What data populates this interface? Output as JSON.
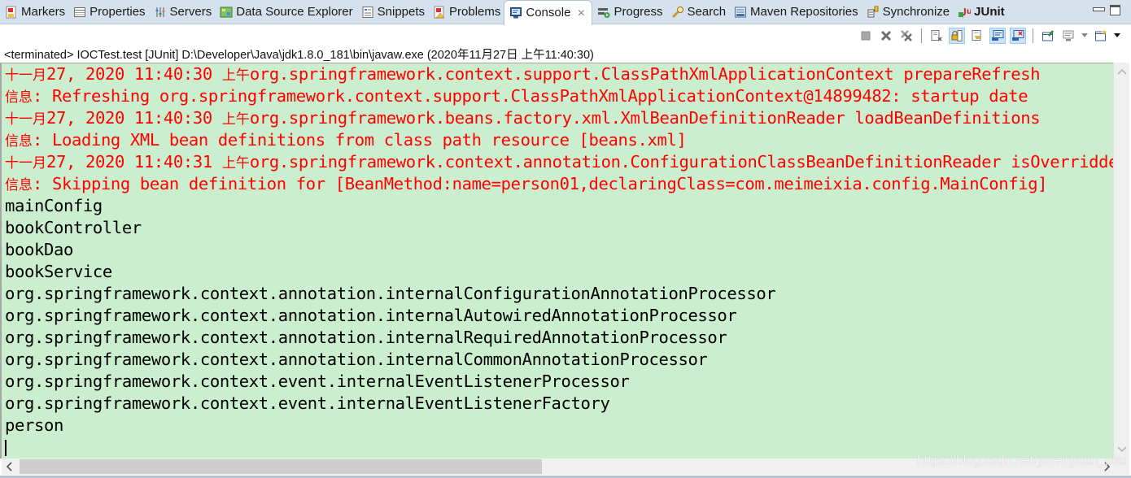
{
  "tabs": [
    {
      "label": "Markers",
      "icon": "markers-icon"
    },
    {
      "label": "Properties",
      "icon": "properties-icon"
    },
    {
      "label": "Servers",
      "icon": "servers-icon"
    },
    {
      "label": "Data Source Explorer",
      "icon": "data-source-explorer-icon"
    },
    {
      "label": "Snippets",
      "icon": "snippets-icon"
    },
    {
      "label": "Problems",
      "icon": "problems-icon"
    },
    {
      "label": "Console",
      "icon": "console-icon",
      "active": true,
      "close_glyph": "✕"
    },
    {
      "label": "Progress",
      "icon": "progress-icon"
    },
    {
      "label": "Search",
      "icon": "search-icon"
    },
    {
      "label": "Maven Repositories",
      "icon": "maven-repositories-icon"
    },
    {
      "label": "Synchronize",
      "icon": "synchronize-icon"
    },
    {
      "label": "JUnit",
      "icon": "junit-icon"
    }
  ],
  "toolbar": {
    "buttons": [
      {
        "name": "terminate",
        "icon": "stop-icon"
      },
      {
        "name": "remove-launch",
        "icon": "remove-icon"
      },
      {
        "name": "remove-all-terminated",
        "icon": "remove-all-icon"
      },
      {
        "name": "clear-console",
        "icon": "clear-console-icon"
      },
      {
        "name": "scroll-lock",
        "icon": "scroll-lock-icon",
        "pressed": true
      },
      {
        "name": "word-wrap",
        "icon": "word-wrap-icon"
      },
      {
        "name": "show-console-on-stdout",
        "icon": "show-stdout-icon",
        "pressed": true
      },
      {
        "name": "show-console-on-stderr",
        "icon": "show-stderr-icon",
        "pressed": true
      },
      {
        "name": "pin-console",
        "icon": "pin-icon"
      },
      {
        "name": "display-selected-console",
        "icon": "display-console-icon"
      },
      {
        "name": "open-console",
        "icon": "new-console-icon"
      }
    ]
  },
  "process_label": "<terminated> IOCTest.test [JUnit] D:\\Developer\\Java\\jdk1.8.0_181\\bin\\javaw.exe (2020年11月27日 上午11:40:30)",
  "console": {
    "lines": [
      {
        "type": "err",
        "prefix": "十一月",
        "text": "27, 2020 11:40:30 ",
        "ampm": "上午",
        "rest": "org.springframework.context.support.ClassPathXmlApplicationContext prepareRefresh"
      },
      {
        "type": "err",
        "prefix": "信息",
        "text": ": Refreshing org.springframework.context.support.ClassPathXmlApplicationContext@14899482: startup date"
      },
      {
        "type": "err",
        "prefix": "十一月",
        "text": "27, 2020 11:40:30 ",
        "ampm": "上午",
        "rest": "org.springframework.beans.factory.xml.XmlBeanDefinitionReader loadBeanDefinitions"
      },
      {
        "type": "err",
        "prefix": "信息",
        "text": ": Loading XML bean definitions from class path resource [beans.xml]"
      },
      {
        "type": "err",
        "prefix": "十一月",
        "text": "27, 2020 11:40:31 ",
        "ampm": "上午",
        "rest": "org.springframework.context.annotation.ConfigurationClassBeanDefinitionReader isOverriddenByExistingBeanDefinition"
      },
      {
        "type": "err",
        "prefix": "信息",
        "text": ": Skipping bean definition for [BeanMethod:name=person01,declaringClass=com.meimeixia.config.MainConfig]"
      },
      {
        "type": "out",
        "text": "mainConfig"
      },
      {
        "type": "out",
        "text": "bookController"
      },
      {
        "type": "out",
        "text": "bookDao"
      },
      {
        "type": "out",
        "text": "bookService"
      },
      {
        "type": "out",
        "text": "org.springframework.context.annotation.internalConfigurationAnnotationProcessor"
      },
      {
        "type": "out",
        "text": "org.springframework.context.annotation.internalAutowiredAnnotationProcessor"
      },
      {
        "type": "out",
        "text": "org.springframework.context.annotation.internalRequiredAnnotationProcessor"
      },
      {
        "type": "out",
        "text": "org.springframework.context.annotation.internalCommonAnnotationProcessor"
      },
      {
        "type": "out",
        "text": "org.springframework.context.event.internalEventListenerProcessor"
      },
      {
        "type": "out",
        "text": "org.springframework.context.event.internalEventListenerFactory"
      },
      {
        "type": "out",
        "text": "person"
      }
    ]
  },
  "colors": {
    "console_bg": "#cbeece",
    "stderr": "#ff0000",
    "stdout": "#000000",
    "tabbar_bg": "#d6e1ee"
  },
  "watermark": "https://blog.csdn.net/yerenyuan_pku"
}
